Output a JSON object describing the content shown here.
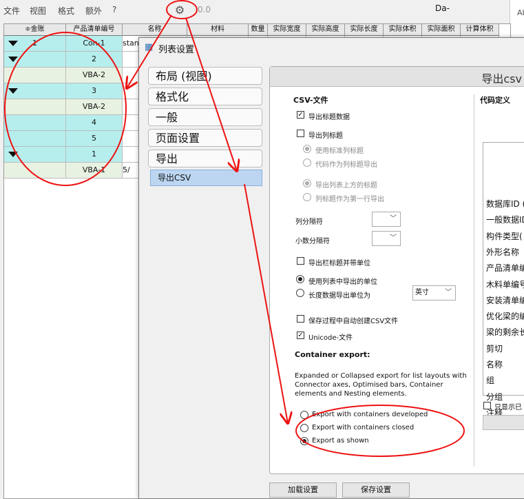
{
  "menu": {
    "items": [
      "文件",
      "视图",
      "格式",
      "额外",
      "?"
    ],
    "value": "0.0",
    "right_text": "Da-"
  },
  "side_label": "Ab",
  "table": {
    "headers": [
      "≑金账",
      "产品清单编号",
      "名称",
      "材料",
      "数量",
      "实际宽度",
      "实际高度",
      "实际长度",
      "实际体积",
      "实际面积",
      "计算体积"
    ],
    "rows": [
      {
        "tri": true,
        "num": "1",
        "code": "Con-1",
        "name": "standa",
        "style": "cyan"
      },
      {
        "tri": true,
        "num": "",
        "code": "2",
        "name": "",
        "style": "cyan"
      },
      {
        "tri": false,
        "num": "",
        "code": "VBA-2",
        "name": "",
        "style": "green"
      },
      {
        "tri": true,
        "num": "",
        "code": "3",
        "name": "",
        "style": "cyan"
      },
      {
        "tri": false,
        "num": "",
        "code": "VBA-2",
        "name": "",
        "style": "green"
      },
      {
        "tri": false,
        "num": "",
        "code": "4",
        "name": "",
        "style": "cyan"
      },
      {
        "tri": false,
        "num": "",
        "code": "5",
        "name": "",
        "style": "cyan"
      },
      {
        "tri": true,
        "num": "",
        "code": "1",
        "name": "",
        "style": "cyan"
      },
      {
        "tri": false,
        "num": "",
        "code": "VBA-1",
        "name": "5/",
        "style": "green"
      }
    ]
  },
  "dialog": {
    "title": "列表设置",
    "nav": [
      "布局 (视图)",
      "格式化",
      "一般",
      "页面设置",
      "导出"
    ],
    "nav_sub": "导出CSV",
    "panel_title": "导出csv",
    "csv_header": "CSV-文件",
    "export_header_data": "导出标题数据",
    "export_column_titles": "导出列标题",
    "use_standard_titles": "使用标准列标题",
    "code_as_titles": "代码作为列标题导出",
    "export_above_title": "导出列表上方的标题",
    "title_first_row": "列标题作为第一行导出",
    "col_separator": "列分隔符",
    "decimal_separator": "小数分隔符",
    "bar_title_units": "导出栏标题并带单位",
    "use_list_units": "使用列表中导出的单位",
    "length_unit": "长度数据导出单位为",
    "unit_value": "英寸",
    "auto_create_csv": "保存过程中自动创建CSV文件",
    "unicode_file": "Unicode-文件",
    "container_header": "Container export:",
    "container_desc": "Expanded or Collapsed export for list layouts with Connector axes, Optimised bars, Container elements and Nesting elements.",
    "opt_developed": "Export with containers developed",
    "opt_closed": "Export with containers closed",
    "opt_shown": "Export as shown",
    "code_def_header": "代码定义",
    "codes": [
      "数据库ID (",
      "一般数据ID",
      "构件类型(",
      "外形名称",
      "产品清单编",
      "木料单编号",
      "安装清单编",
      "优化梁的编",
      "梁的剩余长",
      "剪切",
      "名称",
      "组",
      "分组",
      "注释"
    ],
    "only_show": "只显示已",
    "load_btn": "加载设置",
    "save_btn": "保存设置"
  }
}
